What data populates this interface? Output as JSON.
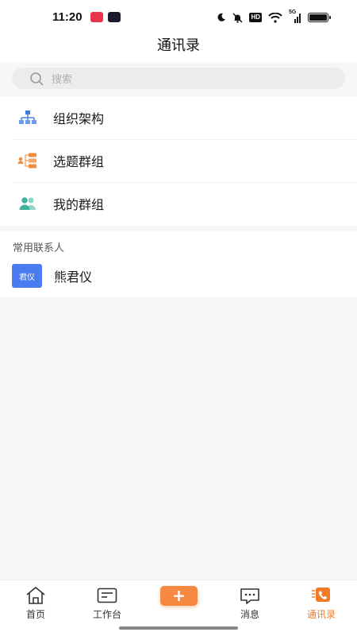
{
  "status_bar": {
    "time": "11:20",
    "network_label": "HD",
    "signal_label": "5G"
  },
  "header": {
    "title": "通讯录"
  },
  "search": {
    "placeholder": "搜索"
  },
  "menu": {
    "items": [
      {
        "label": "组织架构",
        "icon": "org-chart-icon",
        "color": "#3e7be0"
      },
      {
        "label": "选题群组",
        "icon": "topic-group-icon",
        "color": "#f08c3c"
      },
      {
        "label": "我的群组",
        "icon": "my-group-icon",
        "color": "#3fb39a"
      }
    ]
  },
  "contacts": {
    "heading": "常用联系人",
    "items": [
      {
        "avatar_text": "君仪",
        "name": "熊君仪",
        "avatar_color": "#4a7bf0"
      }
    ]
  },
  "tab_bar": {
    "active_color": "#f07c28",
    "tabs": [
      {
        "label": "首页",
        "icon": "home-icon"
      },
      {
        "label": "工作台",
        "icon": "workbench-icon"
      },
      {
        "label": "",
        "icon": "add-icon",
        "symbol": "+"
      },
      {
        "label": "消息",
        "icon": "message-icon"
      },
      {
        "label": "通讯录",
        "icon": "contacts-icon",
        "active": true
      }
    ]
  }
}
